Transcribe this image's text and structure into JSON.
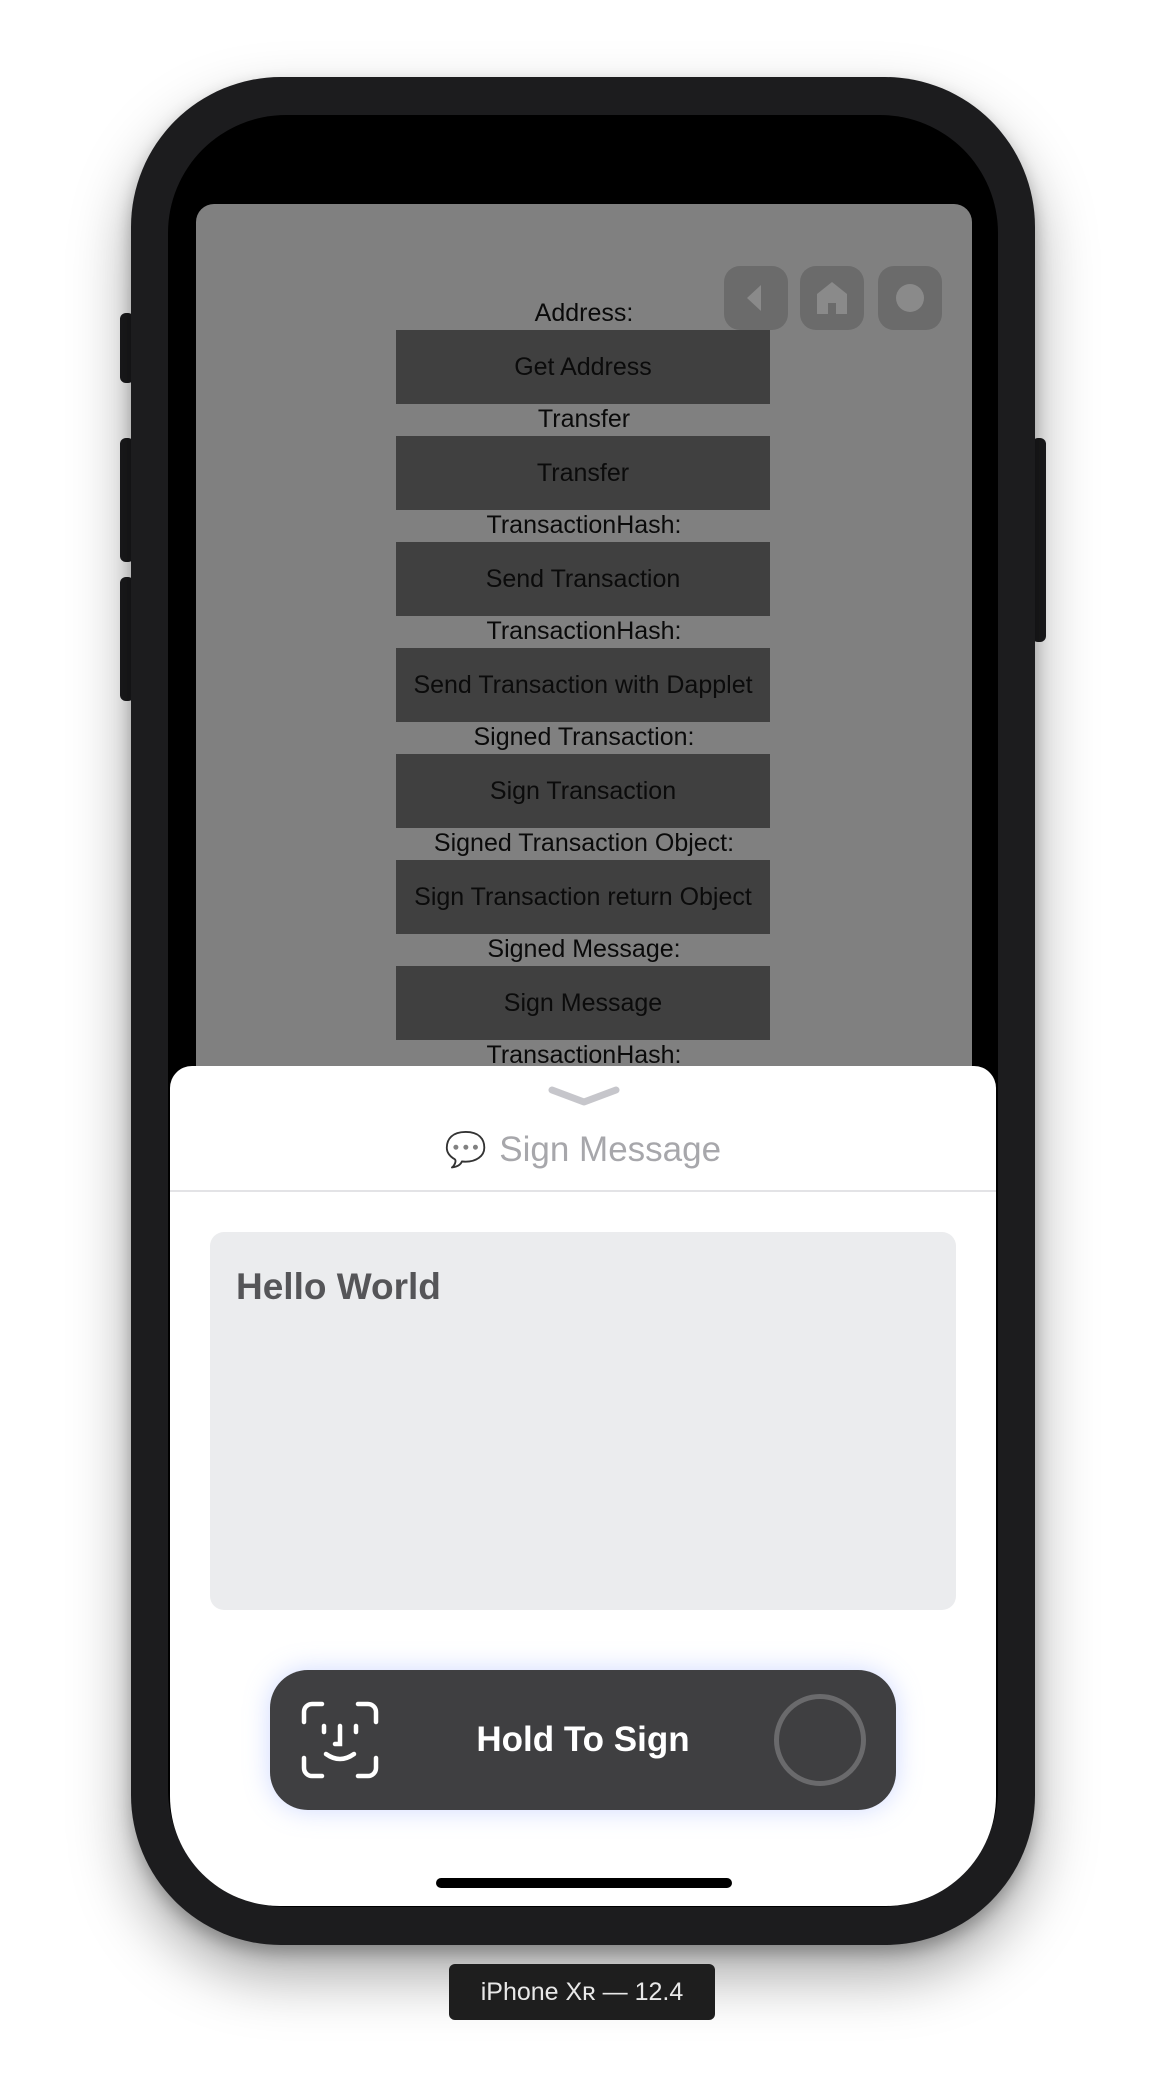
{
  "device_label": "iPhone Xʀ — 12.4",
  "app": {
    "items": [
      {
        "label": "Address:",
        "button": "Get Address"
      },
      {
        "label": "Transfer",
        "button": "Transfer"
      },
      {
        "label": "TransactionHash:",
        "button": "Send Transaction"
      },
      {
        "label": "TransactionHash:",
        "button": "Send Transaction with Dapplet"
      },
      {
        "label": "Signed Transaction:",
        "button": "Sign Transaction"
      },
      {
        "label": "Signed Transaction Object:",
        "button": "Sign Transaction return Object"
      },
      {
        "label": "Signed Message:",
        "button": "Sign Message"
      },
      {
        "label": "TransactionHash:",
        "button": ""
      }
    ],
    "assistive_icons": [
      "back-icon",
      "home-icon",
      "record-icon"
    ]
  },
  "sheet": {
    "title_icon": "💬",
    "title": "Sign Message",
    "message": "Hello World",
    "hold_button_label": "Hold To Sign",
    "colors": {
      "hold_button_bg": "#3f3f41",
      "message_box_bg": "#ebecee",
      "title_color": "#a7a7ab"
    }
  }
}
